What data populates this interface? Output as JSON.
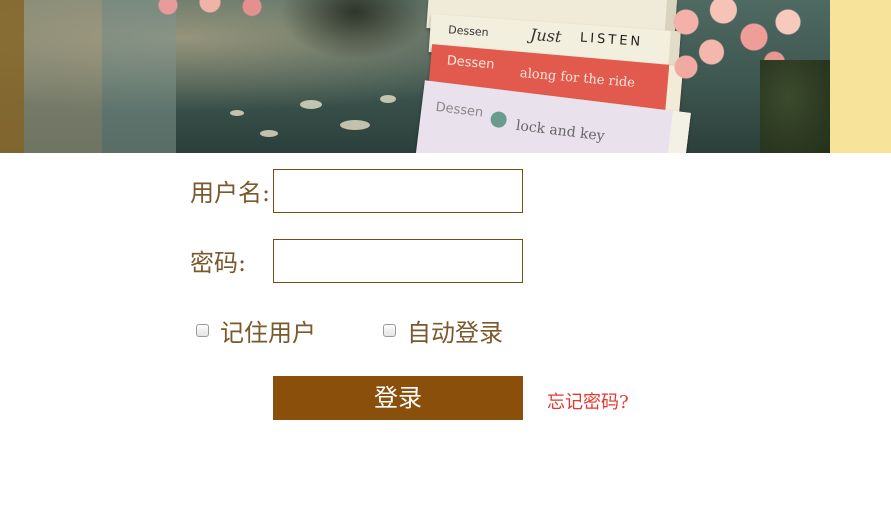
{
  "banner": {
    "image": "books-and-flowers-photo",
    "book_texts": {
      "book1": "",
      "book2_author": "Dessen",
      "book2_title_a": "Just",
      "book2_title_b": "LISTEN",
      "book3_author": "Dessen",
      "book3_title": "along for the ride",
      "book4_author": "Dessen",
      "book4_title": "lock and key"
    }
  },
  "form": {
    "username_label": "用户名:",
    "username_value": "",
    "password_label": "密码:",
    "password_value": "",
    "remember_label": "记住用户",
    "remember_checked": false,
    "auto_login_label": "自动登录",
    "auto_login_checked": false,
    "login_button_label": "登录",
    "forgot_password_link": "忘记密码?"
  },
  "colors": {
    "label_text": "#7a5a2c",
    "input_border": "#7a4a10",
    "button_bg": "#8b4f0c",
    "button_text": "#ffffff",
    "link": "#e8362e",
    "banner_side": "#f7e39a"
  },
  "icons": {
    "remember_checkbox": "checkbox-unchecked",
    "auto_login_checkbox": "checkbox-unchecked"
  }
}
